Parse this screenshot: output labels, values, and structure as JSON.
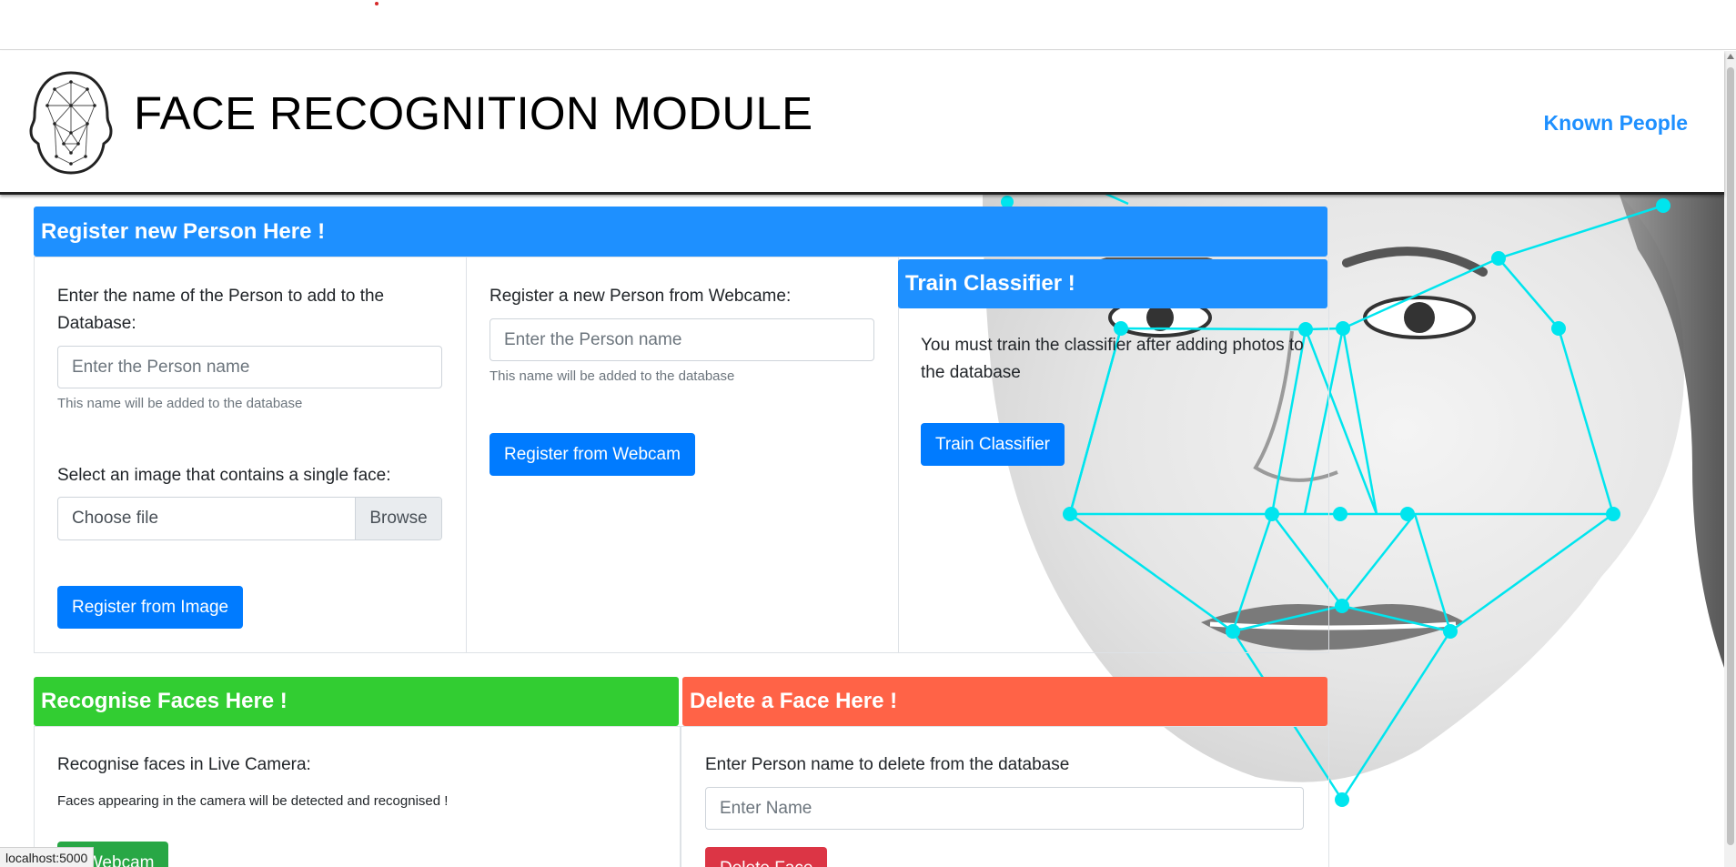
{
  "navbar": {
    "title": "FACE RECOGNITION MODULE",
    "link": "Known People"
  },
  "register": {
    "header": "Register new Person Here !",
    "image_col": {
      "label": "Enter the name of the Person to add to the Database:",
      "placeholder": "Enter the Person name",
      "help": "This name will be added to the database",
      "file_label": "Select an image that contains a single face:",
      "file_placeholder": "Choose file",
      "browse": "Browse",
      "button": "Register from Image"
    },
    "webcam_col": {
      "label": "Register a new Person from Webcame:",
      "placeholder": "Enter the Person name",
      "help": "This name will be added to the database",
      "button": "Register from Webcam"
    }
  },
  "train": {
    "header": "Train Classifier !",
    "text": "You must train the classifier after adding photos to the database",
    "button": "Train Classifier"
  },
  "recognise": {
    "header": "Recognise Faces Here !",
    "label": "Recognise faces in Live Camera:",
    "help": "Faces appearing in the camera will be detected and recognised !",
    "button": "n Webcam"
  },
  "delete": {
    "header": "Delete a Face Here !",
    "label": "Enter Person name to delete from the database",
    "placeholder": "Enter Name",
    "button": "Delete Face"
  },
  "status_bar": "localhost:5000",
  "colors": {
    "blue_header": "#1e90ff",
    "green_header": "#32cd32",
    "red_header": "#ff6347",
    "primary": "#007bff",
    "success": "#28a745",
    "danger": "#dc3545",
    "mesh": "#00e5ee"
  }
}
